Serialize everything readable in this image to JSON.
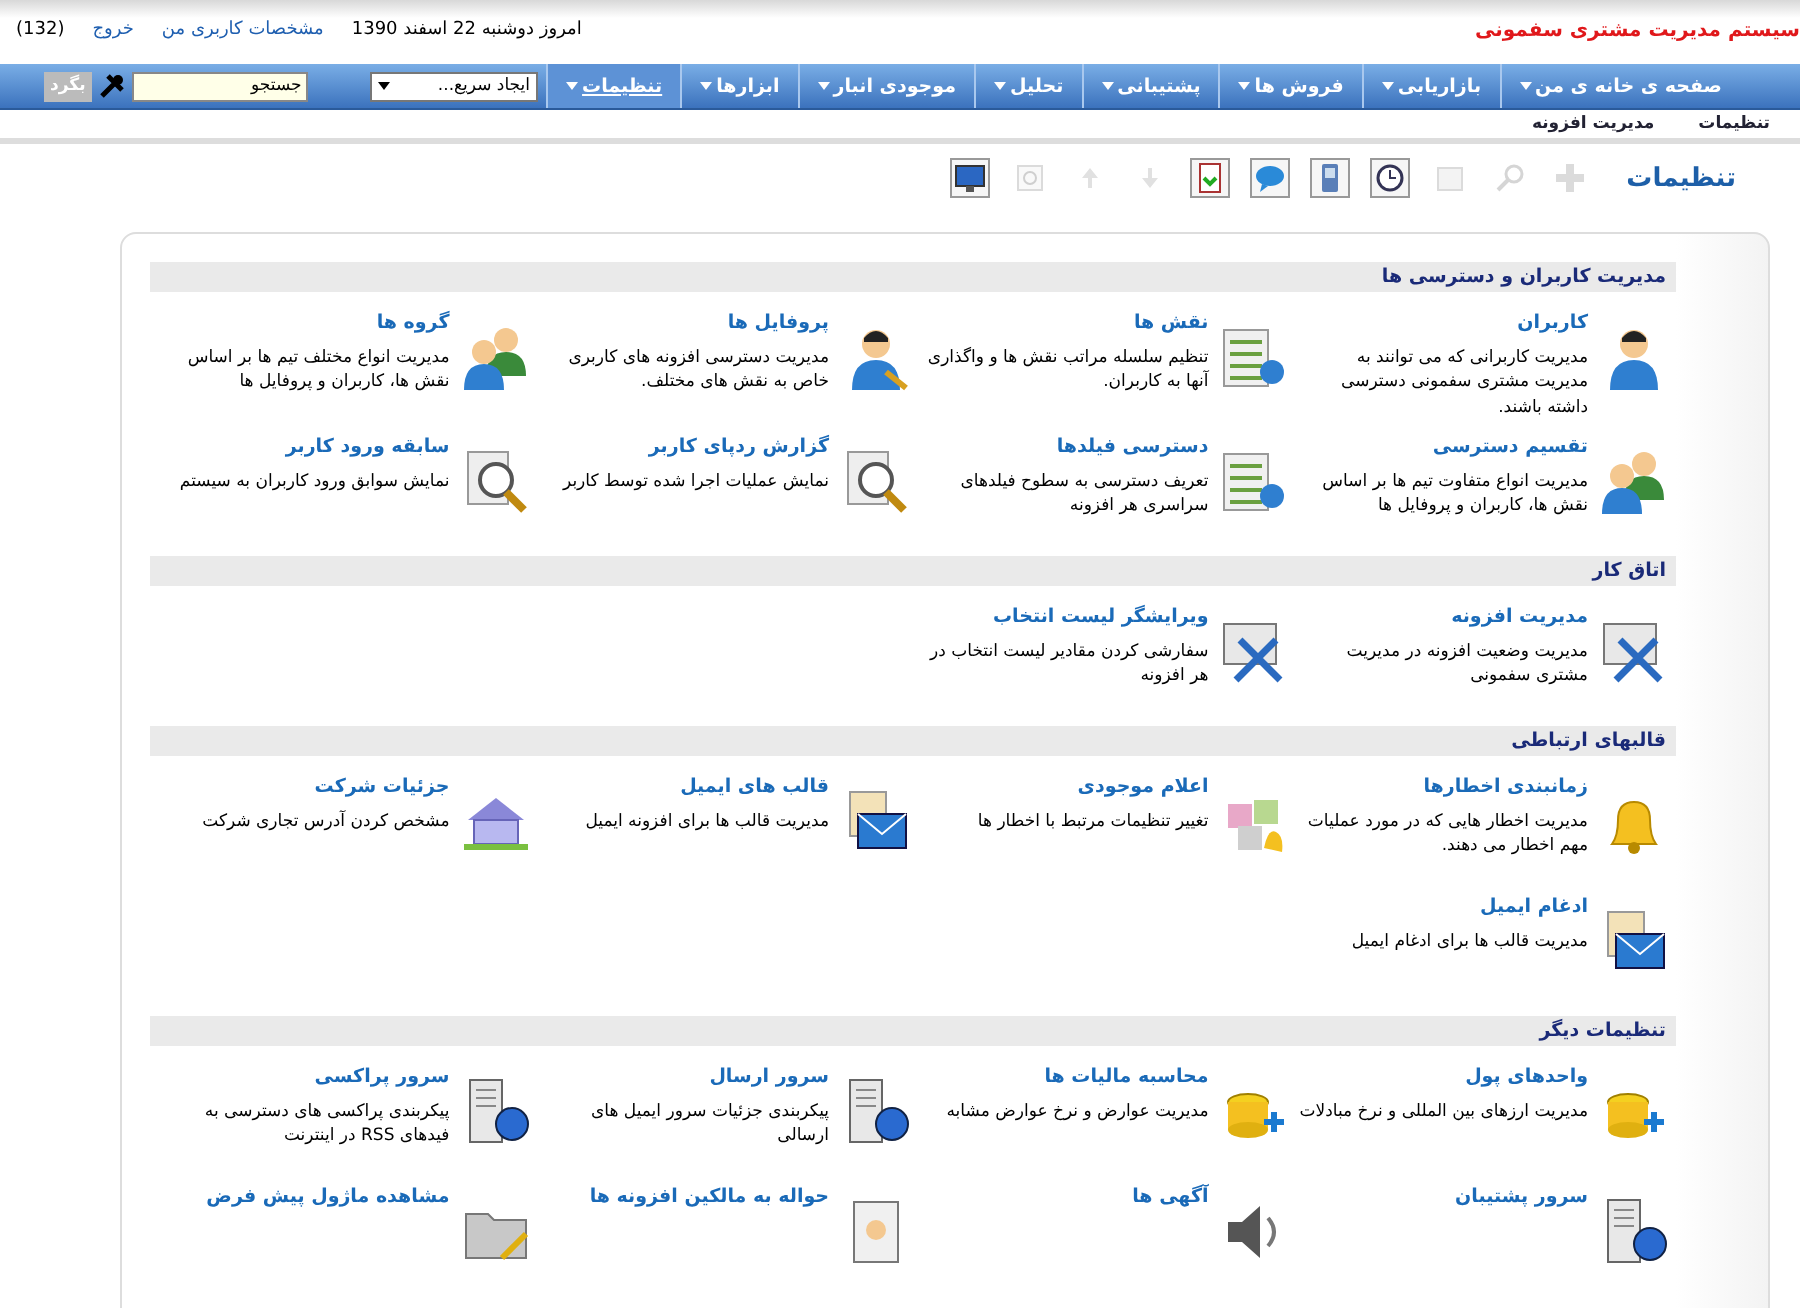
{
  "header": {
    "title": "سیستم مدیریت مشتری سفمونی",
    "date": "امروز دوشنبه 22 اسفند 1390",
    "links": [
      "مشخصات کاربری من",
      "خروج"
    ],
    "count": "(132)"
  },
  "menu": [
    {
      "label": "صفحه ی خانه ی من",
      "selected": false
    },
    {
      "label": "بازاریابی",
      "selected": false
    },
    {
      "label": "فروش ها",
      "selected": false
    },
    {
      "label": "پشتیبانی",
      "selected": false
    },
    {
      "label": "تحلیل",
      "selected": false
    },
    {
      "label": "موجودی انبار",
      "selected": false
    },
    {
      "label": "ابزارها",
      "selected": false
    },
    {
      "label": "تنظیمات",
      "selected": true
    }
  ],
  "quick_create": {
    "value": "ایجاد سریع..."
  },
  "search": {
    "value": "جستجو",
    "button": "بگرد"
  },
  "breadcrumb": [
    "تنظیمات",
    "مدیریت افزونه"
  ],
  "toolbar": {
    "title": "تنظیمات",
    "buttons": [
      {
        "disabled": true
      },
      {
        "disabled": true
      },
      {
        "disabled": true
      },
      {
        "disabled": false
      },
      {
        "disabled": false
      },
      {
        "disabled": false
      },
      {
        "disabled": false
      },
      {
        "disabled": true
      },
      {
        "disabled": true
      },
      {
        "disabled": true
      },
      {
        "disabled": false
      }
    ]
  },
  "sections": [
    {
      "title": "مدیریت کاربران و دسترسی ها",
      "items": [
        {
          "title": "کاربران",
          "description": "مدیریت کاربرانی که می توانند به مدیریت مشتری سفمونی دسترسی داشته باشند."
        },
        {
          "title": "نقش ها",
          "description": "تنظیم سلسله مراتب نقش ها و واگذاری آنها به کاربران."
        },
        {
          "title": "پروفایل ها",
          "description": "مدیریت دسترسی افزونه های کاربری خاص به نقش های مختلف."
        },
        {
          "title": "گروه ها",
          "description": "مدیریت انواع مختلف تیم ها بر اساس نقش ها، کاربران و پروفایل ها"
        },
        {
          "title": "تقسیم دسترسی",
          "description": "مدیریت انواع متفاوت تیم ها بر اساس نقش ها، کاربران و پروفایل ها"
        },
        {
          "title": "دسترسی فیلدها",
          "description": "تعریف دسترسی به سطوح فیلدهای سراسری هر افزونه"
        },
        {
          "title": "گزارش ردپای کاربر",
          "description": "نمایش عملیات اجرا شده توسط کاربر"
        },
        {
          "title": "سابقه ورود کاربر",
          "description": "نمایش سوابق ورود کاربران به سیستم"
        }
      ]
    },
    {
      "title": "اتاق کار",
      "items": [
        {
          "title": "مدیریت افزونه",
          "description": "مدیریت وضعیت افزونه در مدیریت مشتری سفمونی"
        },
        {
          "title": "ویرایشگر لیست انتخاب",
          "description": "سفارشی کردن مقادیر لیست انتخاب در هر افزونه"
        }
      ]
    },
    {
      "title": "قالبهای ارتباطی",
      "items": [
        {
          "title": "زمانبندی اخطارها",
          "description": "مدیریت اخطار هایی که در مورد عملیات مهم اخطار می دهند."
        },
        {
          "title": "اعلام موجودی",
          "description": "تغییر تنظیمات مرتبط با اخطار ها"
        },
        {
          "title": "قالب های ایمیل",
          "description": "مدیریت قالب ها برای افزونه ایمیل"
        },
        {
          "title": "جزئیات شرکت",
          "description": "مشخص کردن آدرس تجاری شرکت"
        },
        {
          "title": "ادغام ایمیل",
          "description": "مدیریت قالب ها برای ادغام ایمیل"
        }
      ]
    },
    {
      "title": "تنظیمات دیگر",
      "items": [
        {
          "title": "واحدهای پول",
          "description": "مدیریت ارزهای بین المللی و نرخ مبادلات"
        },
        {
          "title": "محاسبه مالیات ها",
          "description": "مدیریت عوارض و نرخ عوارض مشابه"
        },
        {
          "title": "سرور ارسال",
          "description": "پیکربندی جزئیات سرور ایمیل های ارسالی"
        },
        {
          "title": "سرور پراکسی",
          "description": "پیکربندی پراکسی های دسترسی به فیدهای RSS در اینترنت"
        },
        {
          "title": "سرور پشتیبان"
        },
        {
          "title": "آگهی ها"
        },
        {
          "title": "حواله به مالکین افزونه ها"
        },
        {
          "title": "مشاهده ماژول پیش فرض"
        }
      ]
    }
  ]
}
